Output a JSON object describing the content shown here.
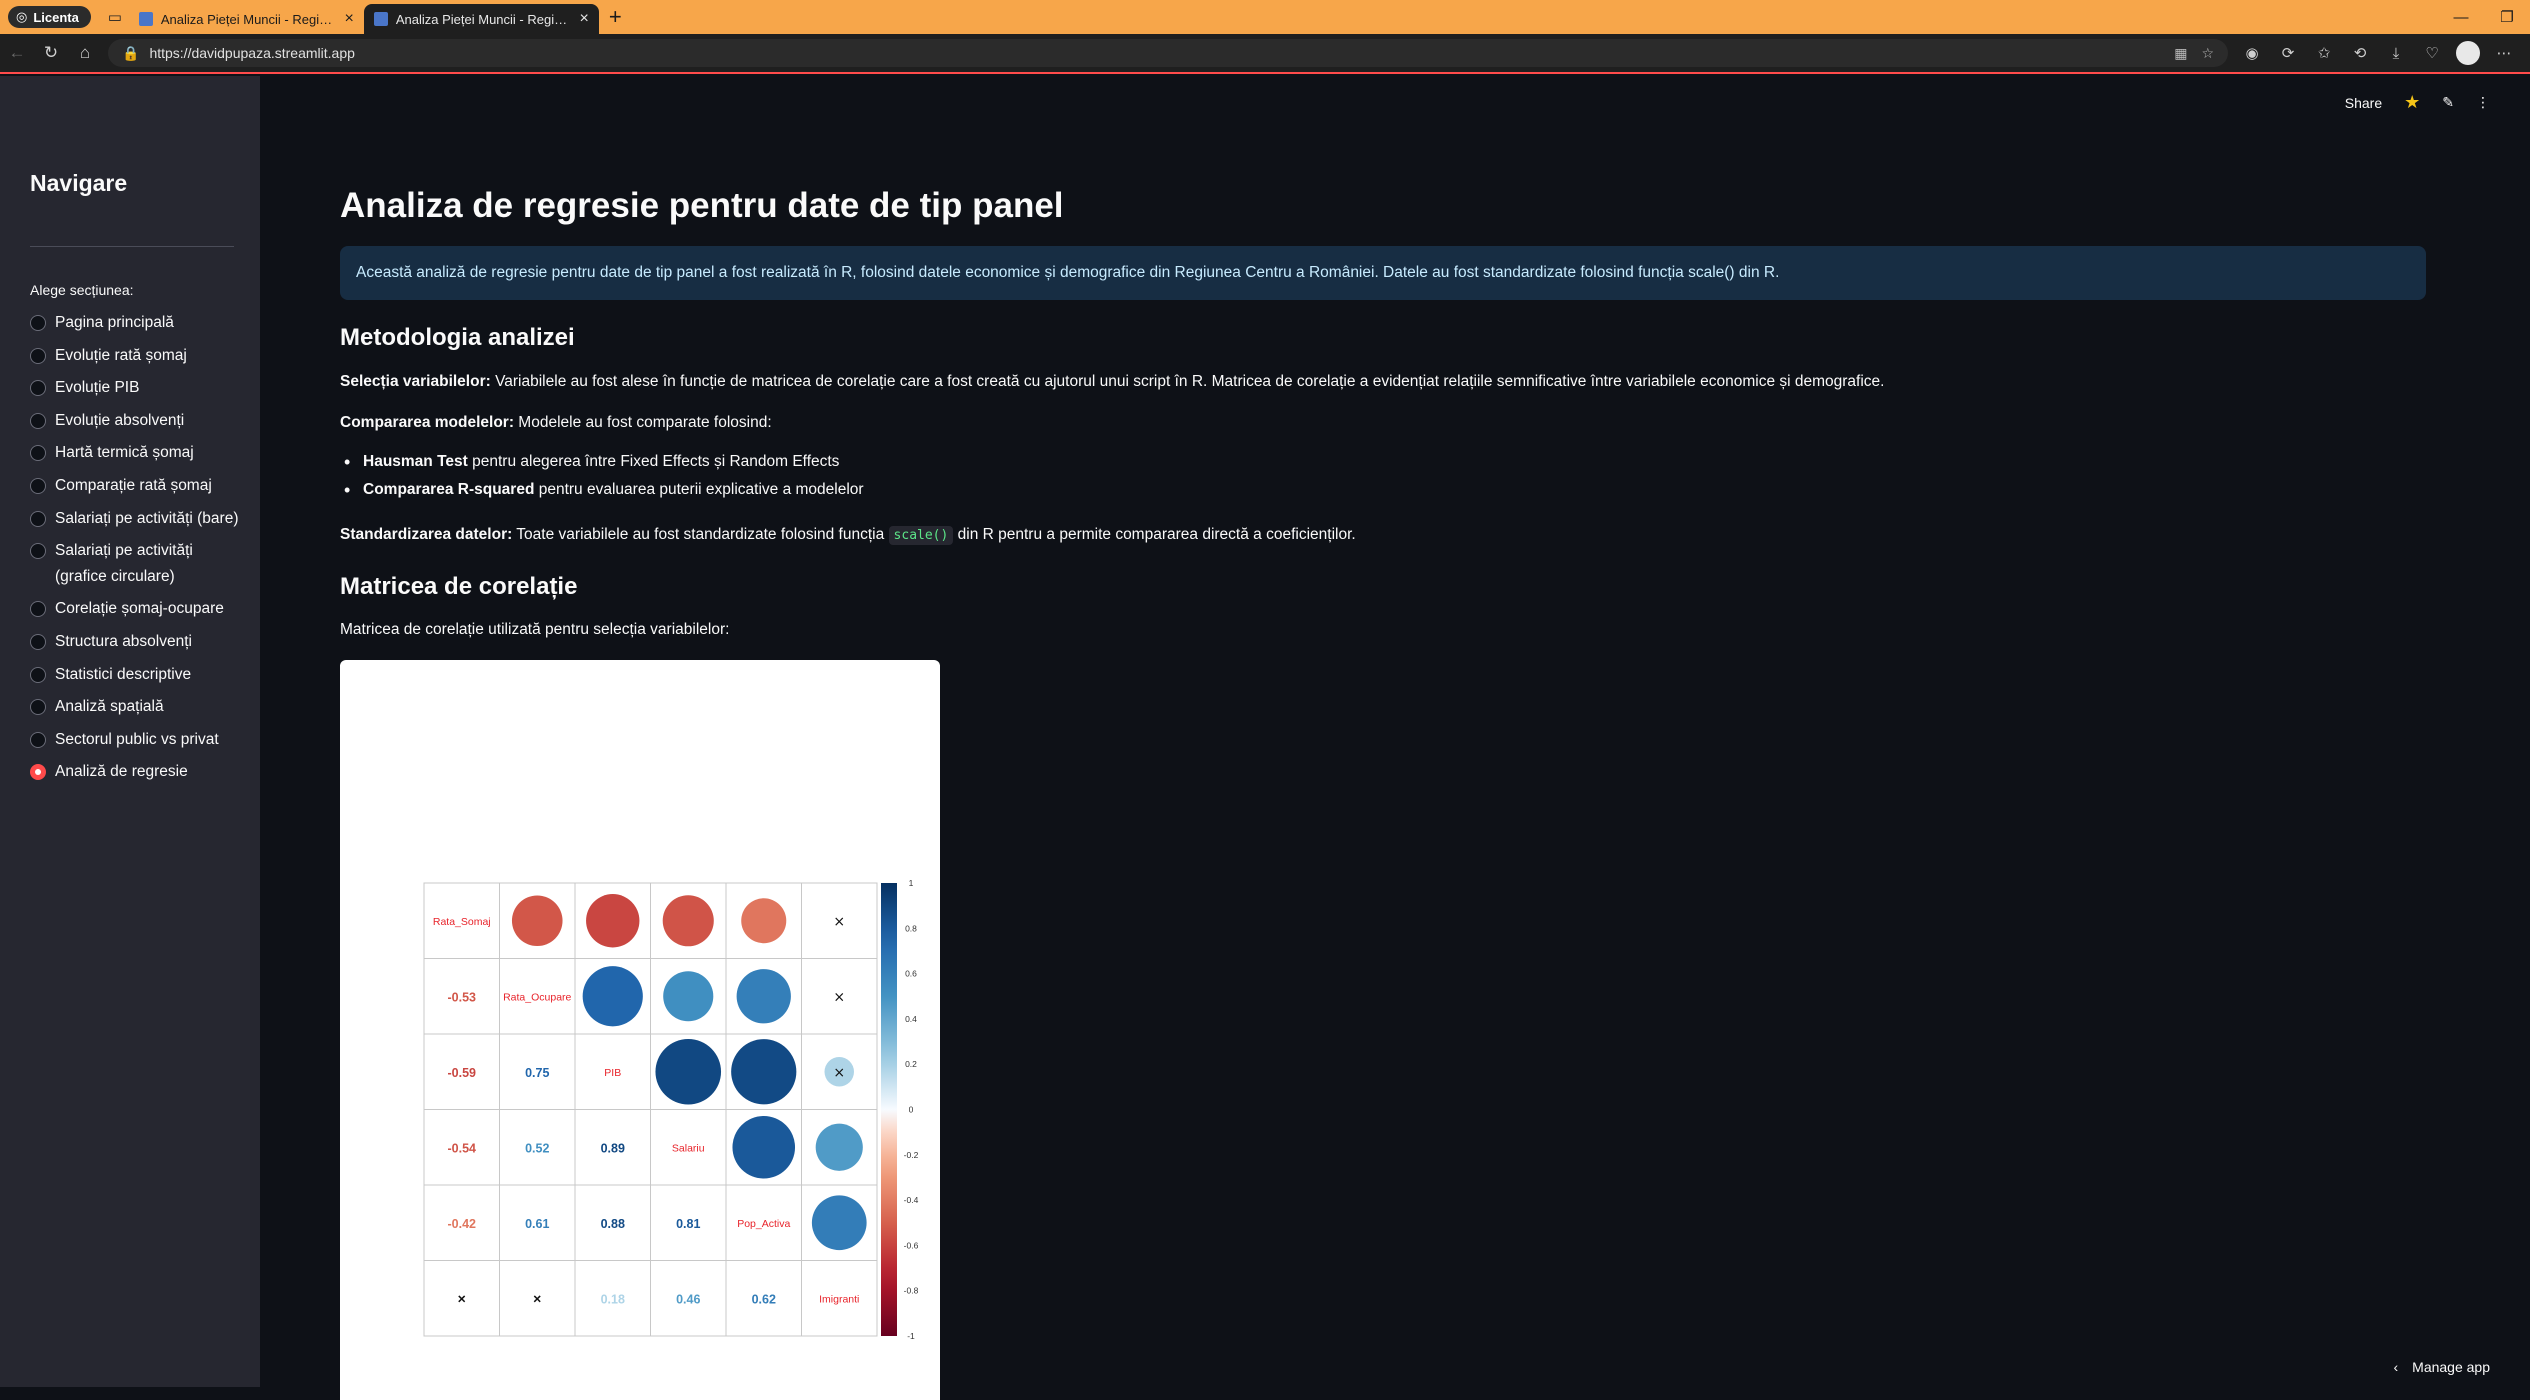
{
  "browser": {
    "profile": "Licenta",
    "tabs": [
      {
        "label": "Analiza Pieței Muncii - Regiunea Centru",
        "active": false
      },
      {
        "label": "Analiza Pieței Muncii - Regiunea Centru",
        "active": true
      }
    ],
    "url": "https://davidpupaza.streamlit.app"
  },
  "header": {
    "share_label": "Share"
  },
  "sidebar": {
    "title": "Navigare",
    "radio_label": "Alege secțiunea:",
    "items": [
      {
        "label": "Pagina principală",
        "selected": false
      },
      {
        "label": "Evoluție rată șomaj",
        "selected": false
      },
      {
        "label": "Evoluție PIB",
        "selected": false
      },
      {
        "label": "Evoluție absolvenți",
        "selected": false
      },
      {
        "label": "Hartă termică șomaj",
        "selected": false
      },
      {
        "label": "Comparație rată șomaj",
        "selected": false
      },
      {
        "label": "Salariați pe activități (bare)",
        "selected": false
      },
      {
        "label": "Salariați pe activități (grafice circulare)",
        "selected": false
      },
      {
        "label": "Corelație șomaj-ocupare",
        "selected": false
      },
      {
        "label": "Structura absolvenți",
        "selected": false
      },
      {
        "label": "Statistici descriptive",
        "selected": false
      },
      {
        "label": "Analiză spațială",
        "selected": false
      },
      {
        "label": "Sectorul public vs privat",
        "selected": false
      },
      {
        "label": "Analiză de regresie",
        "selected": true
      }
    ]
  },
  "main": {
    "title": "Analiza de regresie pentru date de tip panel",
    "info": "Această analiză de regresie pentru date de tip panel a fost realizată în R, folosind datele economice și demografice din Regiunea Centru a României. Datele au fost standardizate folosind funcția scale() din R.",
    "method_heading": "Metodologia analizei",
    "selection_bold": "Selecția variabilelor:",
    "selection_text": " Variabilele au fost alese în funcție de matricea de corelație care a fost creată cu ajutorul unui script în R. Matricea de corelație a evidențiat relațiile semnificative între variabilele economice și demografice.",
    "compare_bold": "Compararea modelelor:",
    "compare_text": " Modelele au fost comparate folosind:",
    "bullets": [
      {
        "bold": "Hausman Test",
        "text": " pentru alegerea între Fixed Effects și Random Effects"
      },
      {
        "bold": "Compararea R-squared",
        "text": " pentru evaluarea puterii explicative a modelelor"
      }
    ],
    "std_bold": "Standardizarea datelor:",
    "std_text_1": " Toate variabilele au fost standardizate folosind funcția ",
    "std_code": "scale()",
    "std_text_2": " din R pentru a permite compararea directă a coeficienților.",
    "matrix_heading": "Matricea de corelație",
    "matrix_caption": "Matricea de corelație utilizată pentru selecția variabilelor:"
  },
  "chart_data": {
    "type": "heatmap",
    "variables": [
      "Rata_Somaj",
      "Rata_Ocupare",
      "PIB",
      "Salariu",
      "Pop_Activa",
      "Imigranti"
    ],
    "lower_labels": [
      [
        null,
        null,
        null,
        null,
        null,
        null
      ],
      [
        "-0.53",
        null,
        null,
        null,
        null,
        null
      ],
      [
        "-0.59",
        "0.75",
        null,
        null,
        null,
        null
      ],
      [
        "-0.54",
        "0.52",
        "0.89",
        null,
        null,
        null
      ],
      [
        "-0.42",
        "0.61",
        "0.88",
        "0.81",
        null,
        null
      ],
      [
        "×",
        "×",
        "0.18",
        "0.46",
        "0.62",
        null
      ]
    ],
    "upper_values": [
      [
        null,
        -0.53,
        -0.59,
        -0.54,
        -0.42,
        null
      ],
      [
        null,
        null,
        0.75,
        0.52,
        0.61,
        null
      ],
      [
        null,
        null,
        null,
        0.89,
        0.88,
        0.18
      ],
      [
        null,
        null,
        null,
        null,
        0.81,
        0.46
      ],
      [
        null,
        null,
        null,
        null,
        null,
        0.62
      ],
      [
        null,
        null,
        null,
        null,
        null,
        null
      ]
    ],
    "upper_crossed": [
      [
        0,
        5
      ],
      [
        1,
        5
      ],
      [
        2,
        5
      ]
    ],
    "colorbar_ticks": [
      "1",
      "0.8",
      "0.6",
      "0.4",
      "0.2",
      "0",
      "-0.2",
      "-0.4",
      "-0.6",
      "-0.8",
      "-1"
    ],
    "range": [
      -1,
      1
    ]
  },
  "footer": {
    "manage_label": "Manage app"
  }
}
